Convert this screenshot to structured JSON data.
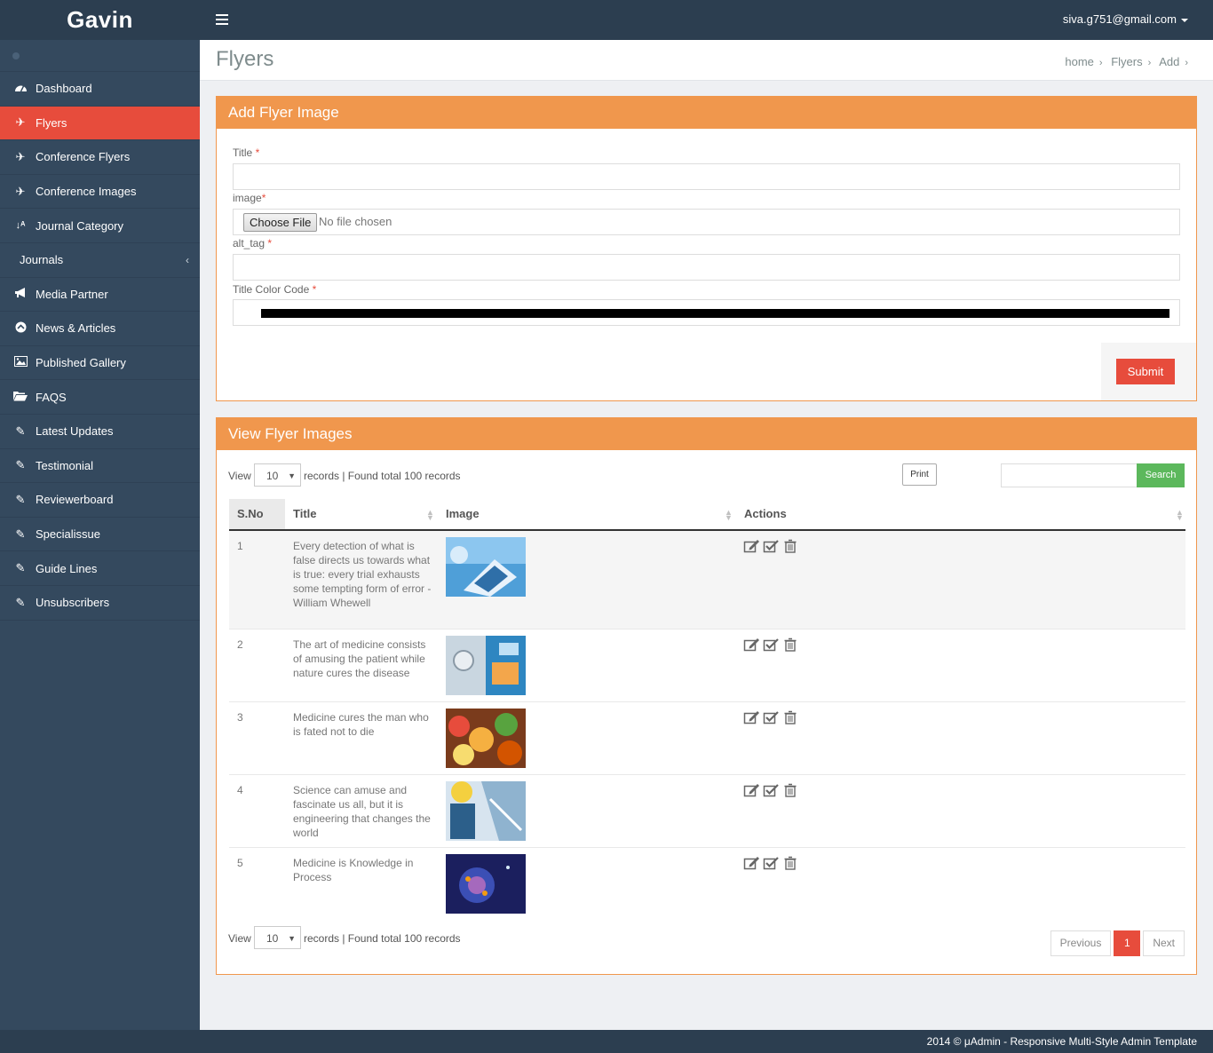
{
  "brand": "Gavin",
  "user_email": "siva.g751@gmail.com",
  "page_title": "Flyers",
  "breadcrumb": [
    "home",
    "Flyers",
    "Add"
  ],
  "sidebar": [
    {
      "label": "Dashboard",
      "icon": "dashboard-icon"
    },
    {
      "label": "Flyers",
      "icon": "plane-icon",
      "active": true
    },
    {
      "label": "Conference Flyers",
      "icon": "plane-icon"
    },
    {
      "label": "Conference Images",
      "icon": "plane-icon"
    },
    {
      "label": "Journal Category",
      "icon": "sort-alpha-icon"
    },
    {
      "label": "Journals",
      "icon": "chevron-left-icon"
    },
    {
      "label": "Media Partner",
      "icon": "bullhorn-icon"
    },
    {
      "label": "News & Articles",
      "icon": "circle-icon"
    },
    {
      "label": "Published Gallery",
      "icon": "picture-icon"
    },
    {
      "label": "FAQS",
      "icon": "folder-open-icon"
    },
    {
      "label": "Latest Updates",
      "icon": "edit-icon"
    },
    {
      "label": "Testimonial",
      "icon": "edit-icon"
    },
    {
      "label": "Reviewerboard",
      "icon": "edit-icon"
    },
    {
      "label": "Specialissue",
      "icon": "edit-icon"
    },
    {
      "label": "Guide Lines",
      "icon": "edit-icon"
    },
    {
      "label": "Unsubscribers",
      "icon": "edit-icon"
    }
  ],
  "add_panel": {
    "heading": "Add Flyer Image",
    "title_label": "Title",
    "image_label": "image",
    "choose_file": "Choose File",
    "no_file": "No file chosen",
    "alt_label": "alt_tag",
    "color_label": "Title Color Code",
    "color_value": "#000000",
    "required_mark": "*",
    "submit": "Submit"
  },
  "view_panel": {
    "heading": "View Flyer Images",
    "view_label": "View",
    "page_size": "10",
    "records_text": "records | Found total 100 records",
    "print": "Print",
    "search": "Search",
    "columns": [
      "S.No",
      "Title",
      "Image",
      "Actions"
    ],
    "rows": [
      {
        "sno": "1",
        "title": "Every detection of what is false directs us towards what is true: every trial exhausts some tempting form of error -William Whewell"
      },
      {
        "sno": "2",
        "title": "The art of medicine consists of amusing the patient while nature cures the disease"
      },
      {
        "sno": "3",
        "title": "Medicine cures the man who is fated not to die"
      },
      {
        "sno": "4",
        "title": "Science can amuse and fascinate us all, but it is engineering that changes the world"
      },
      {
        "sno": "5",
        "title": "Medicine is Knowledge in Process"
      }
    ],
    "pager": {
      "prev": "Previous",
      "current": "1",
      "next": "Next"
    }
  },
  "footer": "2014 © μAdmin - Responsive Multi-Style Admin Template"
}
